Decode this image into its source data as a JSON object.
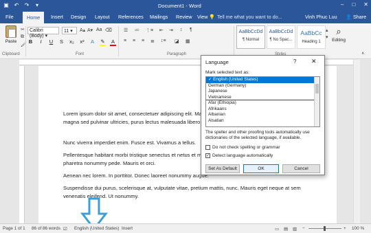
{
  "window": {
    "title": "Document1 - Word",
    "controls": [
      "–",
      "□",
      "✕"
    ]
  },
  "quick_access": [
    "save-icon",
    "undo-icon",
    "redo-icon",
    "customize-icon"
  ],
  "tabs": [
    "File",
    "Home",
    "Insert",
    "Design",
    "Layout",
    "References",
    "Mailings",
    "Review",
    "View"
  ],
  "active_tab": "Home",
  "tell_me": "Tell me what you want to do...",
  "user": "Vinh Phuc Luu",
  "share": "Share",
  "ribbon": {
    "paste": "Paste",
    "font_name": "Calibri (Body)",
    "font_size": "11",
    "groups": [
      "Clipboard",
      "Font",
      "Paragraph",
      "Styles"
    ],
    "styles": [
      {
        "sample": "AaBbCcDd",
        "name": "¶ Normal"
      },
      {
        "sample": "AaBbCcDd",
        "name": "¶ No Spac..."
      },
      {
        "sample": "AaBbCc",
        "name": "Heading 1"
      }
    ],
    "editing": "Editing"
  },
  "document": {
    "paragraphs": [
      "Lorem ipsum dolor sit amet, consectetuer adipiscing elit. Maecenas porttitor congue massa. Fusce posuere, magna sed pulvinar ultricies, purus lectus malesuada libero, sit amet commodo magna eros quis urna.",
      "Nunc viverra imperdiet enim. Fusce est. Vivamus a tellus.",
      "Pellentesque habitant morbi tristique senectus et netus et malesuada fames ac turpis egestas. Proin pharetra nonummy pede. Mauris et orci.",
      "Aenean nec lorem. In porttitor. Donec laoreet nonummy augue.",
      "Suspendisse dui purus, scelerisque at, vulputate vitae, pretium mattis, nunc. Mauris eget neque at sem venenatis eleifend. Ut nonummy."
    ]
  },
  "dialog": {
    "title": "Language",
    "help": "?",
    "close": "✕",
    "mark_label": "Mark selected text as:",
    "languages": [
      "English (United States)",
      "German (Germany)",
      "Japanese",
      "Vietnamese",
      "Afar (Ethiopia)",
      "Afrikaans",
      "Albanian",
      "Alsatian"
    ],
    "selected_language": "English (United States)",
    "description": "The speller and other proofing tools automatically use dictionaries of the selected language, if available.",
    "checkbox_no_check": "Do not check spelling or grammar",
    "checkbox_detect": "Detect language automatically",
    "no_check_checked": false,
    "detect_checked": true,
    "btn_default": "Set As Default",
    "btn_ok": "OK",
    "btn_cancel": "Cancel"
  },
  "status": {
    "page": "Page 1 of 1",
    "words": "86 of 86 words",
    "language": "English (United States)",
    "mode": "Insert",
    "zoom": "100 %"
  },
  "colors": {
    "word_blue": "#2b579a",
    "selection": "#0078d7",
    "arrow": "#3a9fd8"
  }
}
